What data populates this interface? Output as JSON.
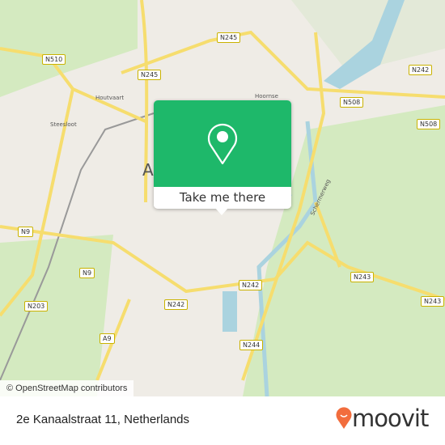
{
  "map": {
    "road_labels": [
      "N510",
      "N245",
      "N245",
      "N242",
      "N508",
      "N508",
      "N9",
      "N9",
      "N203",
      "A9",
      "N242",
      "N242",
      "N244",
      "N243",
      "N243"
    ],
    "street_labels": [
      "Houtvaart",
      "Steesloot",
      "Hoornse",
      "Schermerweg"
    ],
    "city_label": "A",
    "attribution": "© OpenStreetMap contributors",
    "colors": {
      "land": "#efece6",
      "green": "#d4eac0",
      "water": "#aad3df",
      "road": "#f6dd6e"
    }
  },
  "popup": {
    "icon": "location-pin-icon",
    "button_label": "Take me there",
    "color": "#1eb86a"
  },
  "footer": {
    "address": "2e Kanaalstraat 11, Netherlands",
    "logo_text": "moovit",
    "logo_color": "#f26d3d"
  }
}
